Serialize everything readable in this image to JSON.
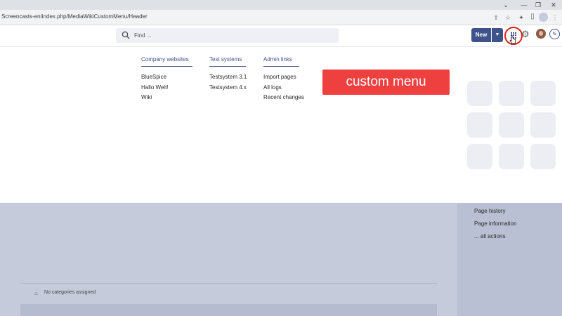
{
  "browser": {
    "url": "Screencasts-en/index.php/MediaWikiCustomMenu/Header",
    "window_controls": [
      "⌄",
      "—",
      "❐",
      "✕"
    ]
  },
  "header": {
    "search_placeholder": "Find ...",
    "new_label": "New",
    "accent_color": "#3e5389",
    "highlight_color": "#d9241f"
  },
  "menu": {
    "columns": [
      {
        "heading": "Company websites",
        "links": [
          "BlueSpice",
          "Hallo Welt!",
          "Wiki"
        ]
      },
      {
        "heading": "Test systems",
        "links": [
          "Testsystem 3.1",
          "Testsystem 4.x"
        ]
      },
      {
        "heading": "Admin links",
        "links": [
          "Import pages",
          "All logs",
          "Recent changes"
        ]
      }
    ],
    "banner_text": "custom menu",
    "banner_color": "#ef4040"
  },
  "sidebar": {
    "links": [
      "Page history",
      "Page information",
      "... all actions"
    ]
  },
  "footer": {
    "categories_text": "No categories assigned"
  }
}
